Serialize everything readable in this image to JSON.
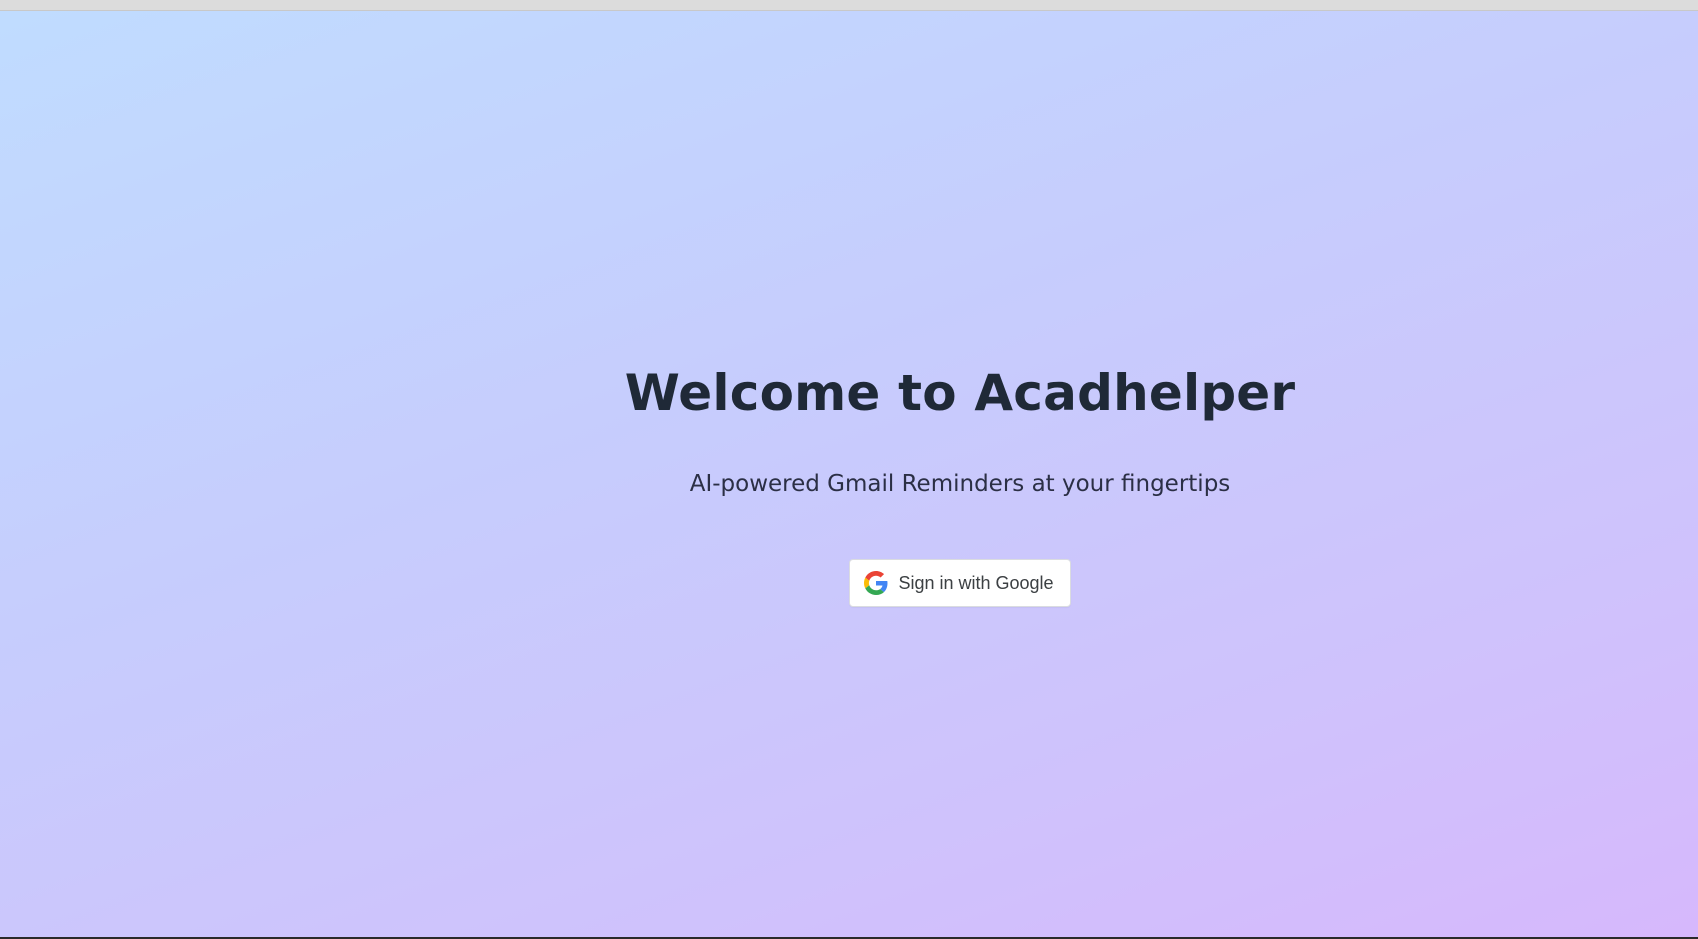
{
  "hero": {
    "title": "Welcome to Acadhelper",
    "subtitle": "AI-powered Gmail Reminders at your fingertips"
  },
  "auth": {
    "signin_label": "Sign in with Google",
    "icon": "google-g-icon"
  },
  "colors": {
    "gradient_start": "#c0dcff",
    "gradient_end": "#d6b8fc",
    "title": "#1f2937",
    "button_bg": "#ffffff"
  }
}
